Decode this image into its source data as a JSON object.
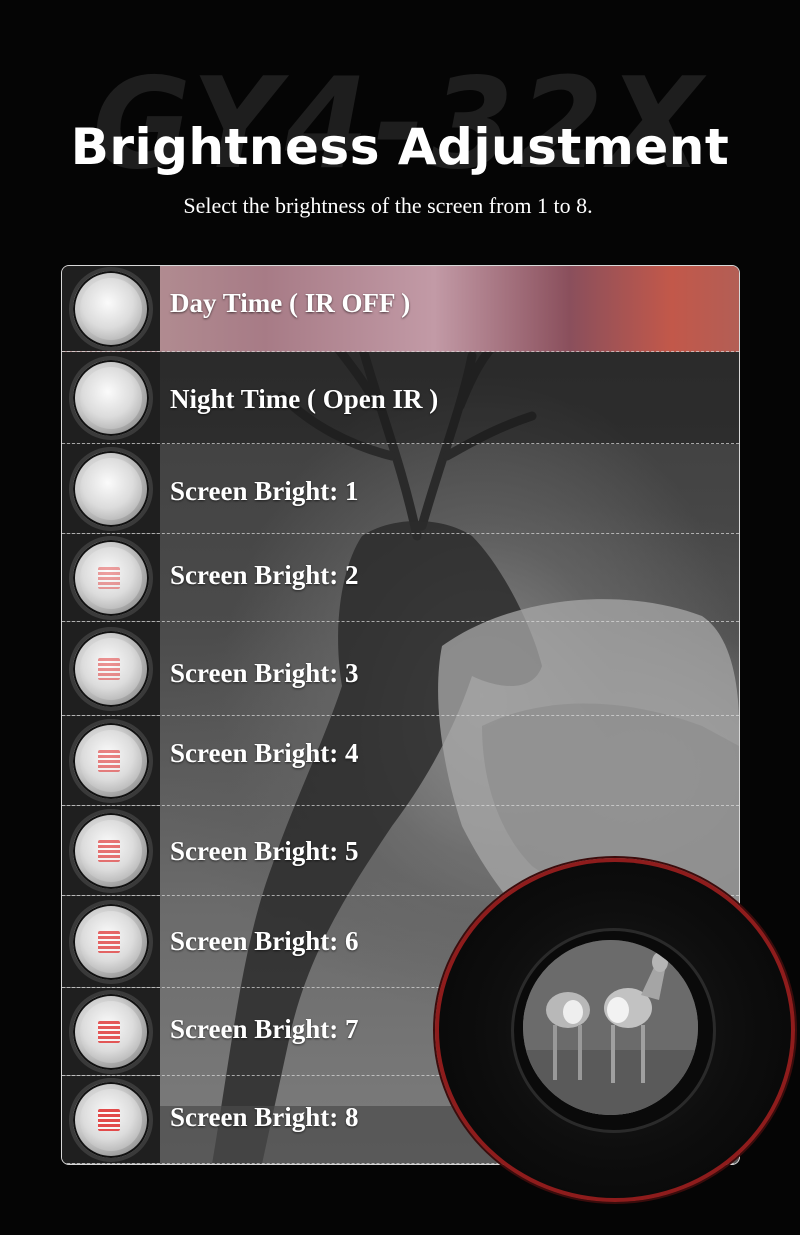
{
  "background_word": "GY4-32X",
  "header": {
    "title": "Brightness Adjustment",
    "subtitle": "Select the brightness of the screen from 1 to 8."
  },
  "modes": [
    {
      "label": "Day Time ( IR OFF )",
      "bright_level": 0
    },
    {
      "label": "Night Time ( Open IR )",
      "bright_level": 0
    },
    {
      "label": "Screen Bright: 1",
      "bright_level": 1
    },
    {
      "label": "Screen Bright: 2",
      "bright_level": 2
    },
    {
      "label": "Screen Bright: 3",
      "bright_level": 3
    },
    {
      "label": "Screen Bright: 4",
      "bright_level": 4
    },
    {
      "label": "Screen Bright: 5",
      "bright_level": 5
    },
    {
      "label": "Screen Bright: 6",
      "bright_level": 6
    },
    {
      "label": "Screen Bright: 7",
      "bright_level": 7
    },
    {
      "label": "Screen Bright: 8",
      "bright_level": 8
    }
  ],
  "colors": {
    "accent_red": "#8e1c1c",
    "ir_red": "#e24848",
    "panel_border": "#d8d8d8"
  }
}
